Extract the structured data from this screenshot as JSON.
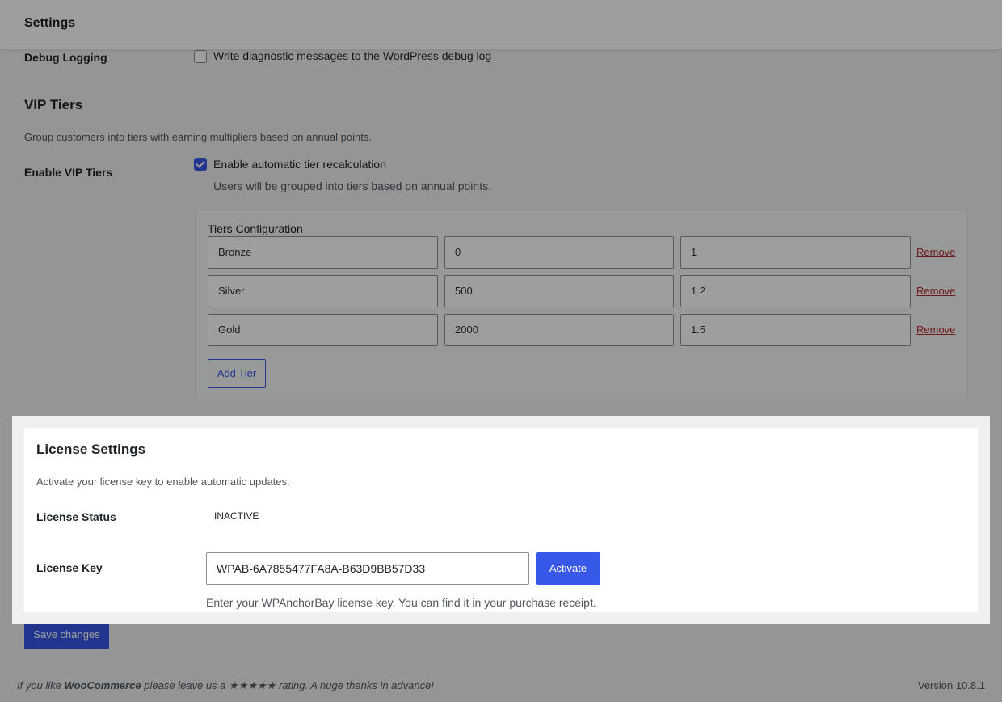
{
  "header": {
    "title": "Settings"
  },
  "debug": {
    "label": "Debug Logging",
    "checkbox_label": "Write diagnostic messages to the WordPress debug log",
    "checked": false
  },
  "vip": {
    "heading": "VIP Tiers",
    "description": "Group customers into tiers with earning multipliers based on annual points.",
    "enable_label": "Enable VIP Tiers",
    "checkbox_label": "Enable automatic tier recalculation",
    "checked": true,
    "help": "Users will be grouped into tiers based on annual points.",
    "config_title": "Tiers Configuration",
    "tiers": [
      {
        "name": "Bronze",
        "points": "0",
        "multiplier": "1",
        "remove_label": "Remove"
      },
      {
        "name": "Silver",
        "points": "500",
        "multiplier": "1.2",
        "remove_label": "Remove"
      },
      {
        "name": "Gold",
        "points": "2000",
        "multiplier": "1.5",
        "remove_label": "Remove"
      }
    ],
    "add_tier_label": "Add Tier"
  },
  "license": {
    "heading": "License Settings",
    "description": "Activate your license key to enable automatic updates.",
    "status_label": "License Status",
    "status_value": "INACTIVE",
    "key_label": "License Key",
    "key_value": "WPAB-6A7855477FA8A-B63D9BB57D33",
    "activate_label": "Activate",
    "help": "Enter your WPAnchorBay license key. You can find it in your purchase receipt."
  },
  "save_label": "Save changes",
  "footer": {
    "text_before": "If you like ",
    "brand": "WooCommerce",
    "text_after": " please leave us a ★★★★★ rating. A huge thanks in advance!",
    "version": "Version 10.8.1"
  },
  "colors": {
    "accent": "#3858e9",
    "danger": "#b32d2e"
  }
}
